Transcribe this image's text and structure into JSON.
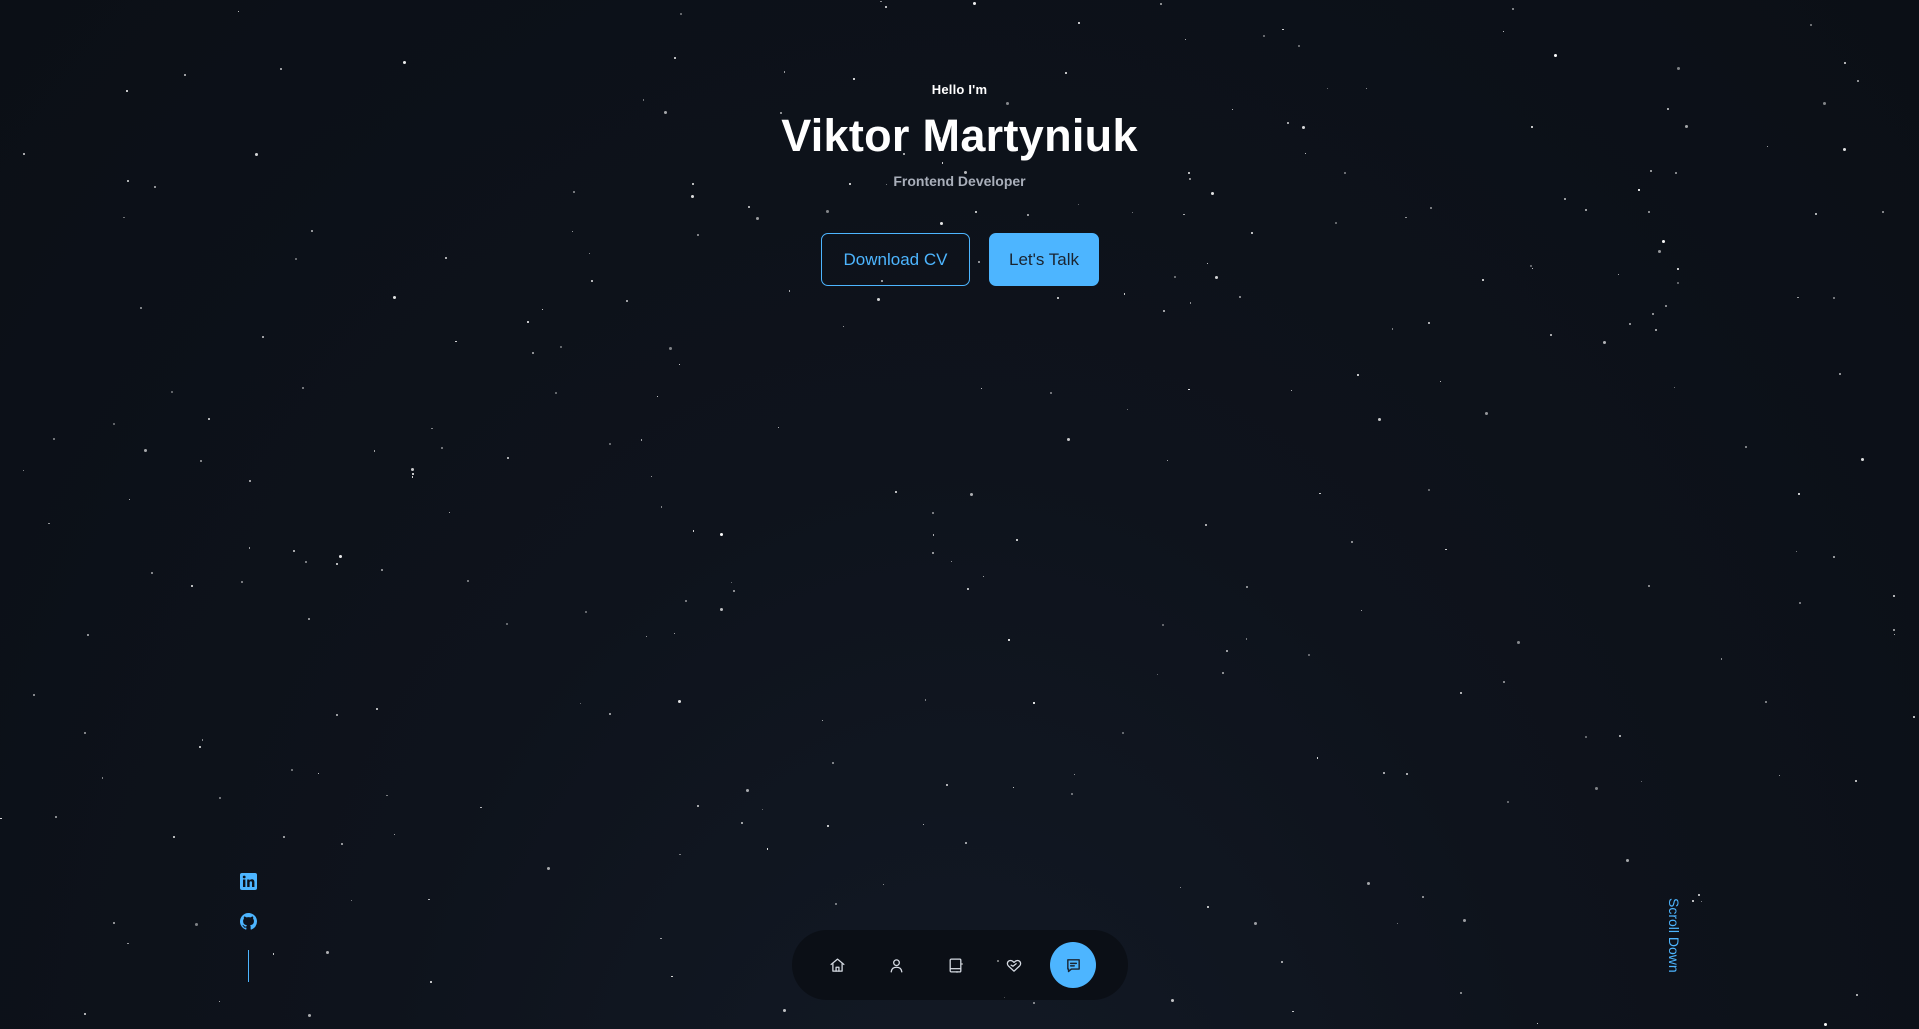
{
  "hero": {
    "greeting": "Hello I'm",
    "name": "Viktor Martyniuk",
    "role": "Frontend Developer",
    "download_label": "Download CV",
    "talk_label": "Let's Talk"
  },
  "socials": {
    "items": [
      {
        "icon": "linkedin-icon"
      },
      {
        "icon": "github-icon"
      }
    ]
  },
  "scroll": {
    "label": "Scroll Down"
  },
  "nav": {
    "items": [
      {
        "icon": "home-icon",
        "active": false
      },
      {
        "icon": "user-icon",
        "active": false
      },
      {
        "icon": "book-icon",
        "active": false
      },
      {
        "icon": "service-icon",
        "active": false
      },
      {
        "icon": "message-icon",
        "active": true
      }
    ]
  },
  "colors": {
    "accent": "#4db5ff",
    "background": "#0d121a",
    "text": "#ffffff",
    "muted_text": "#a9afba"
  }
}
